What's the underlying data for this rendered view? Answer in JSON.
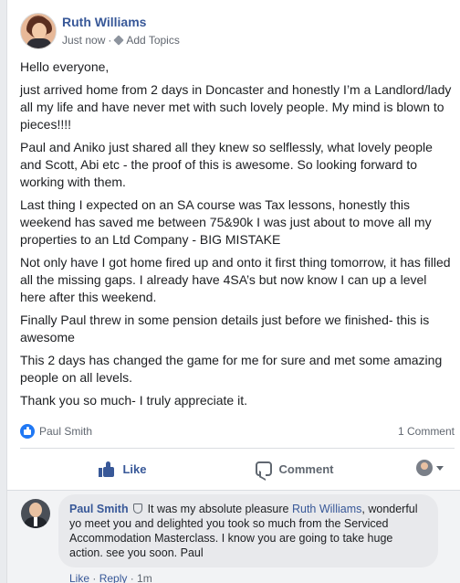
{
  "post": {
    "author": "Ruth Williams",
    "timestamp": "Just now",
    "separator": "·",
    "add_topics": "Add Topics",
    "paragraphs": [
      "Hello everyone,",
      "just arrived home from 2 days in Doncaster and honestly I’m a Landlord/lady all my life and have never met with such lovely people. My mind is blown to pieces!!!!",
      "Paul and Aniko just shared all they knew so selflessly, what lovely people and Scott, Abi etc - the proof of this is awesome. So looking forward to working with them.",
      "Last thing I expected on an SA course was Tax lessons, honestly this weekend has saved me between 75&90k I was just about to move all my properties to an Ltd Company - BIG MISTAKE",
      "Not only have I got home fired up and onto it first thing tomorrow, it has filled all the missing gaps. I already have 4SA’s but now know I can up a level here after this weekend.",
      "Finally Paul threw in some pension details just before we finished- this is awesome",
      "This 2 days has changed the game for me for sure and met some amazing people on all levels.",
      "Thank you so much- I truly appreciate it."
    ]
  },
  "reactions": {
    "reactor_name": "Paul Smith",
    "comment_count": "1 Comment"
  },
  "actions": {
    "like_label": "Like",
    "comment_label": "Comment"
  },
  "comment": {
    "author": "Paul Smith",
    "text_before": "It was my absolute pleasure ",
    "mention": "Ruth Williams",
    "text_after": ", wonderful yo meet you and delighted you took so much from the Serviced Accommodation Masterclass. I know you are going to take huge action. see you soon. Paul",
    "like": "Like",
    "dot": " · ",
    "reply": "Reply",
    "age": "1m"
  },
  "colors": {
    "link_blue": "#385898",
    "like_badge": "#2078f4",
    "comment_bg": "#f2f3f5"
  }
}
